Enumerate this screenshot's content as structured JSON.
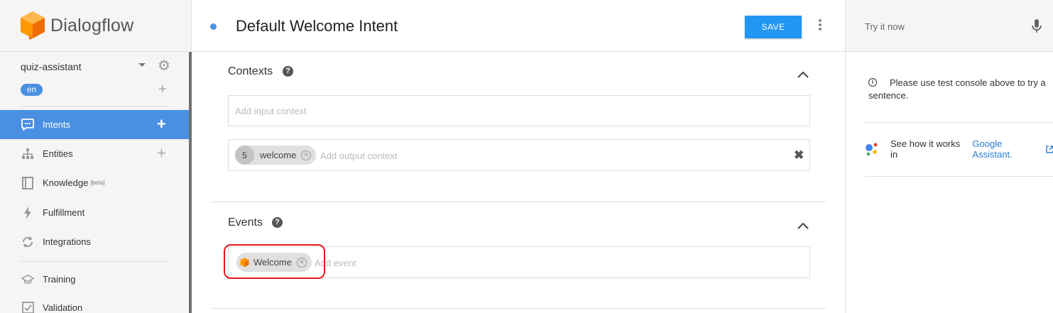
{
  "app": {
    "name": "Dialogflow"
  },
  "agent": {
    "name": "quiz-assistant",
    "language": "en"
  },
  "sidebar": {
    "items": [
      {
        "label": "Intents",
        "icon": "chat-icon",
        "active": true,
        "has_add": true
      },
      {
        "label": "Entities",
        "icon": "hierarchy-icon",
        "active": false,
        "has_add": true
      },
      {
        "label": "Knowledge",
        "icon": "book-icon",
        "active": false,
        "badge": "[beta]"
      },
      {
        "label": "Fulfillment",
        "icon": "bolt-icon",
        "active": false
      },
      {
        "label": "Integrations",
        "icon": "sync-icon",
        "active": false
      },
      {
        "label": "Training",
        "icon": "graduation-cap-icon",
        "active": false
      },
      {
        "label": "Validation",
        "icon": "checkbox-icon",
        "active": false
      }
    ]
  },
  "header": {
    "title": "Default Welcome Intent",
    "save_label": "SAVE"
  },
  "contexts": {
    "title": "Contexts",
    "input_placeholder": "Add input context",
    "output_placeholder": "Add output context",
    "output_contexts": [
      {
        "lifespan": "5",
        "name": "welcome"
      }
    ]
  },
  "events": {
    "title": "Events",
    "placeholder": "Add event",
    "items": [
      {
        "name": "Welcome"
      }
    ]
  },
  "right_panel": {
    "try_placeholder": "Try it now",
    "info_text": "Please use test console above to try a sentence.",
    "assistant_text": "See how it works in",
    "assistant_link": "Google Assistant."
  },
  "colors": {
    "accent": "#4a90e2",
    "save": "#2196f3",
    "highlight": "#e21a1a",
    "brand_orange": "#f57c00"
  }
}
